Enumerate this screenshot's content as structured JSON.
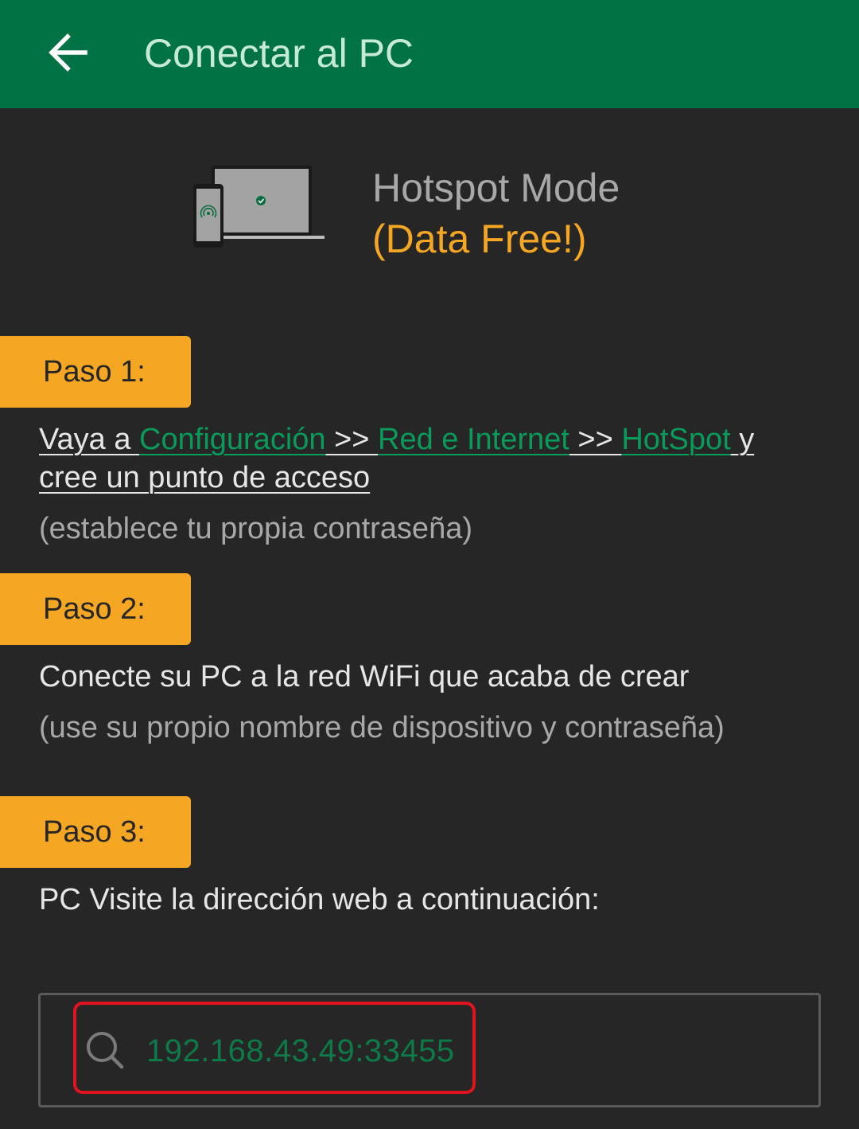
{
  "appbar": {
    "title": "Conectar al PC",
    "back_icon": "arrow-left-icon"
  },
  "hero": {
    "title": "Hotspot Mode",
    "subtitle": "(Data Free!)",
    "illustration_icon": "phone-laptop-hotspot-icon"
  },
  "steps": [
    {
      "label": "Paso 1:",
      "line_prefix": "Vaya a ",
      "link1": "Configuración",
      "sep1": " >> ",
      "link2": "Red e Internet",
      "sep2": " >> ",
      "link3": "HotSpot",
      "line_suffix": " y cree un punto de acceso",
      "note": "(establece tu propia contraseña)"
    },
    {
      "label": "Paso 2:",
      "text": "Conecte su PC a la red WiFi que acaba de crear",
      "note": "(use su propio nombre de dispositivo y contraseña)"
    },
    {
      "label": "Paso 3:",
      "text": "PC Visite la dirección web a continuación:"
    }
  ],
  "address": {
    "value": "192.168.43.49:33455",
    "icon": "search-icon"
  },
  "colors": {
    "appbar": "#007244",
    "background": "#262626",
    "accent": "#f5a623",
    "link": "#0a9a5a",
    "highlight": "#e0141e"
  }
}
